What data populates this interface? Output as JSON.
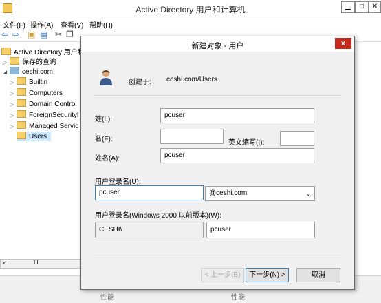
{
  "window": {
    "title": "Active Directory 用户和计算机",
    "min_label": "▁",
    "max_label": "□",
    "close_label": "✕"
  },
  "menu": [
    "文件(F)",
    "操作(A)",
    "查看(V)",
    "帮助(H)"
  ],
  "tree": {
    "root": "Active Directory 用户和",
    "saved_queries": "保存的查询",
    "domain": "ceshi.com",
    "items": [
      "Builtin",
      "Computers",
      "Domain Control",
      "ForeignSecurityl",
      "Managed Servic",
      "Users"
    ],
    "scroll_left": "<",
    "scroll_thumb": "III"
  },
  "statusbar": {
    "cell1": "性能",
    "cell2": "性能"
  },
  "dialog": {
    "title": "新建对象 - 用户",
    "close_label": "x",
    "created_in_label": "创建于:",
    "created_in_value": "ceshi.com/Users",
    "last_name_label": "姓(L):",
    "last_name_value": "pcuser",
    "first_name_label": "名(F):",
    "first_name_value": "",
    "initials_label": "英文缩写(I):",
    "initials_value": "",
    "full_name_label": "姓名(A):",
    "full_name_value": "pcuser",
    "logon_name_label": "用户登录名(U):",
    "logon_name_value": "pcuser",
    "upn_suffix_value": "@ceshi.com",
    "legacy_logon_label": "用户登录名(Windows 2000 以前版本)(W):",
    "legacy_domain_value": "CESHI\\",
    "legacy_name_value": "pcuser",
    "back_button": "< 上一步(B)",
    "next_button": "下一步(N) >",
    "cancel_button": "取消"
  }
}
